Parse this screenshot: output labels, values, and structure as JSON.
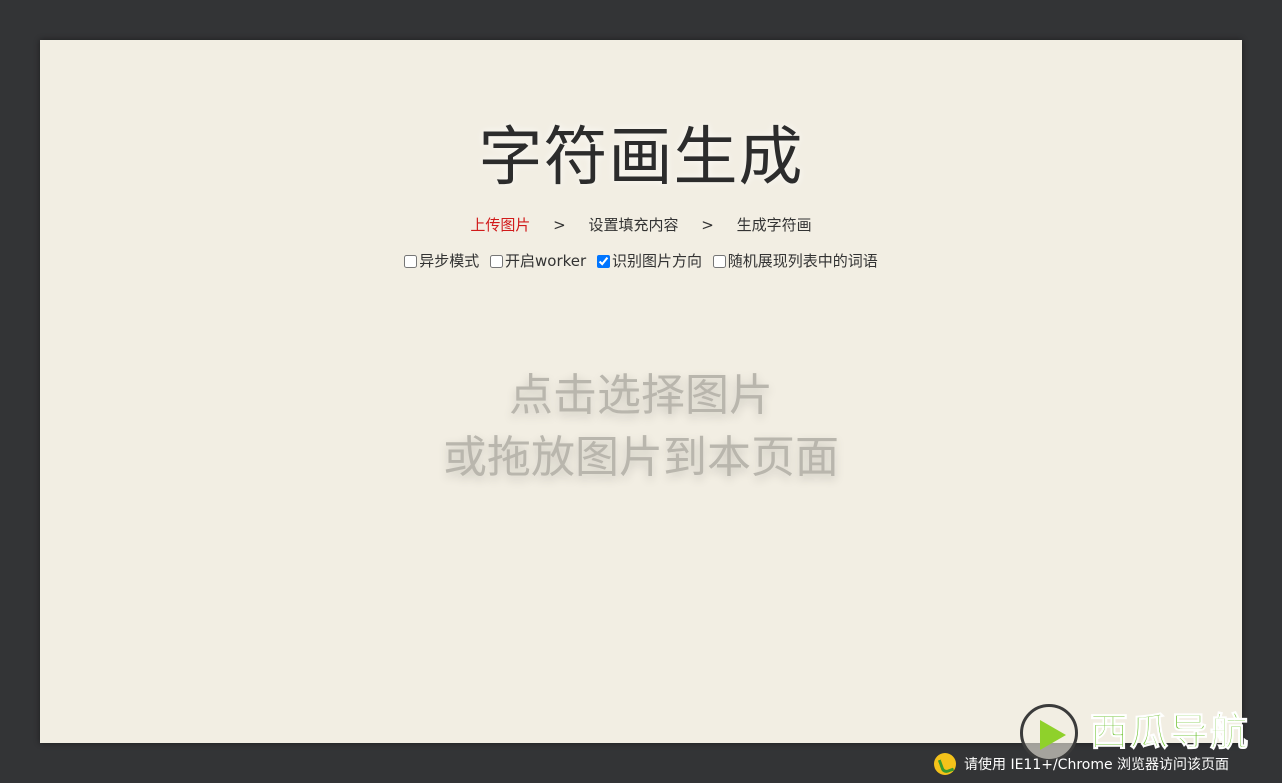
{
  "page": {
    "title": "字符画生成"
  },
  "steps": [
    {
      "label": "上传图片",
      "active": true
    },
    {
      "label": "设置填充内容",
      "active": false
    },
    {
      "label": "生成字符画",
      "active": false
    }
  ],
  "step_separator": ">",
  "options": [
    {
      "label": "异步模式",
      "checked": false
    },
    {
      "label": "开启worker",
      "checked": false
    },
    {
      "label": "识别图片方向",
      "checked": true
    },
    {
      "label": "随机展现列表中的词语",
      "checked": false
    }
  ],
  "dropzone": {
    "line1": "点击选择图片",
    "line2": "或拖放图片到本页面"
  },
  "watermark": {
    "text": "西瓜导航"
  },
  "notice": {
    "text": "请使用 IE11+/Chrome 浏览器访问该页面"
  },
  "colors": {
    "background": "#333436",
    "panel": "#f2eee3",
    "active_step": "#d11a1a",
    "dropzone_text": "#b9b6ad"
  }
}
